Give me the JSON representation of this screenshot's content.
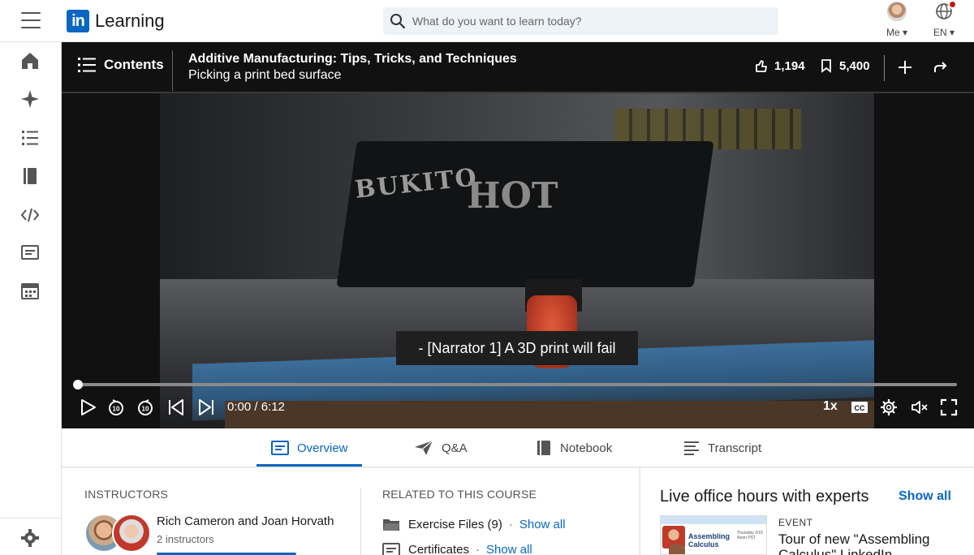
{
  "app": {
    "logo_mark": "in",
    "logo_text": "Learning"
  },
  "search": {
    "placeholder": "What do you want to learn today?",
    "value": ""
  },
  "profile": {
    "me_label": "Me ▾",
    "lang_label": "EN ▾"
  },
  "nav": {
    "items": [
      "home-icon",
      "sparkle-icon",
      "list-icon",
      "book-icon",
      "code-icon",
      "certificate-icon",
      "calendar-icon"
    ],
    "settings": "gear-icon"
  },
  "player": {
    "contents_label": "Contents",
    "course_title": "Additive Manufacturing: Tips, Tricks, and Techniques",
    "video_title": "Picking a print bed surface",
    "likes": "1,194",
    "saves": "5,400",
    "caption": "- [Narrator 1] A 3D print will fail",
    "time": "0:00 / 6:12",
    "progress": 0.0,
    "speed": "1x",
    "cc_label": "CC",
    "skip_label": "10"
  },
  "tabs": [
    {
      "label": "Overview",
      "active": true
    },
    {
      "label": "Q&A",
      "active": false
    },
    {
      "label": "Notebook",
      "active": false
    },
    {
      "label": "Transcript",
      "active": false
    }
  ],
  "instructors": {
    "heading": "INSTRUCTORS",
    "names": "Rich Cameron and Joan Horvath",
    "count": "2 instructors"
  },
  "related": {
    "heading": "RELATED TO THIS COURSE",
    "items": [
      {
        "label": "Exercise Files (9)",
        "separator": "·",
        "link": "Show all"
      },
      {
        "label": "Certificates",
        "separator": "·",
        "link": "Show all"
      }
    ]
  },
  "office_hours": {
    "title": "Live office hours with experts",
    "show_all": "Show all",
    "event_label": "EVENT",
    "event_title": "Tour of new \"Assembling Calculus\" LinkedIn",
    "thumb_title": "Assembling Calculus",
    "thumb_meta": "Thursday 2/15 Noon PST"
  },
  "colors": {
    "accent": "#0a66c2",
    "brand": "#0a66c2",
    "notification": "#cc1016",
    "player_bg": "#111111"
  }
}
